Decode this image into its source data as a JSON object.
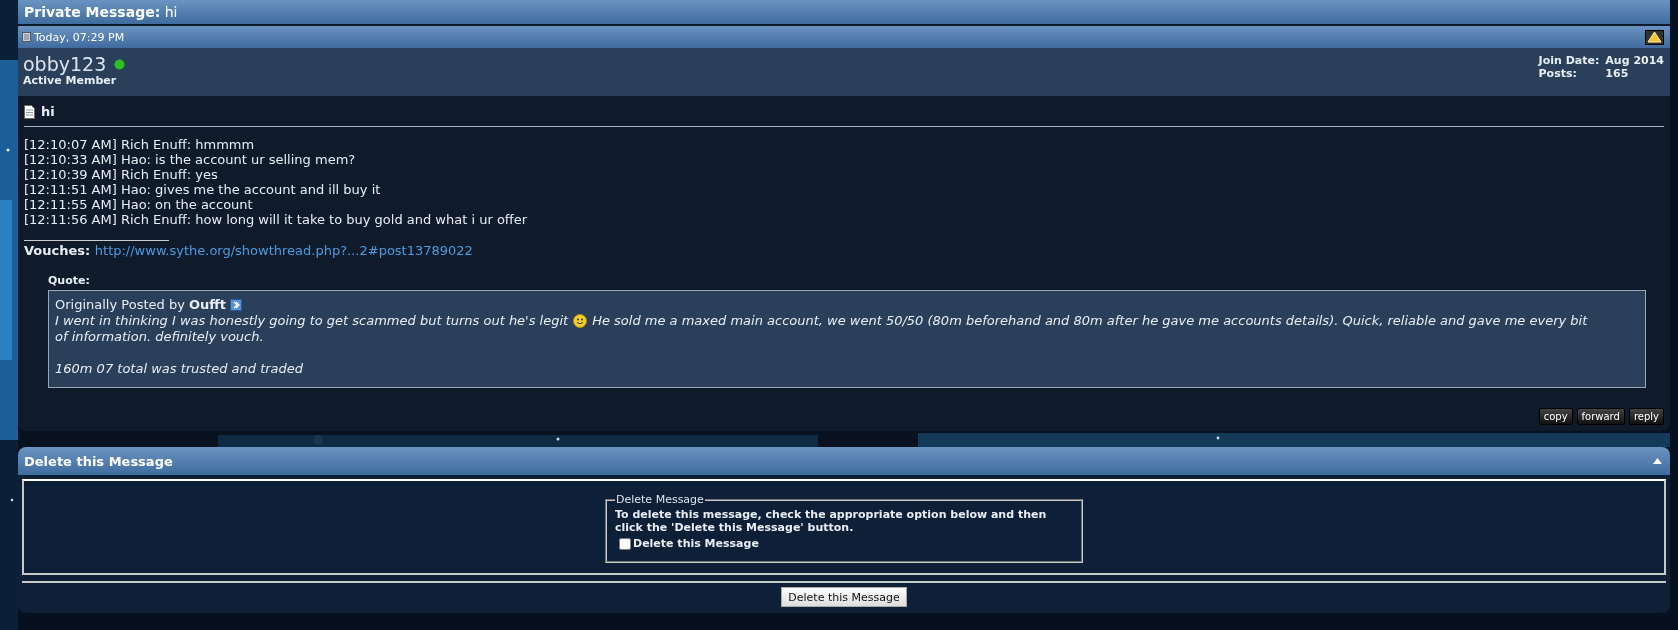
{
  "title": {
    "label": "Private Message:",
    "subject": "hi"
  },
  "post": {
    "date": "Today, 07:29 PM",
    "username": "obby123",
    "online": true,
    "rank": "Active Member",
    "stats": [
      {
        "label": "Join Date:",
        "value": "Aug 2014"
      },
      {
        "label": "Posts:",
        "value": "165"
      }
    ],
    "subject": "hi",
    "lines": [
      "[12:10:07 AM] Rich Enuff: hmmmm",
      "[12:10:33 AM] Hao: is the account ur selling mem?",
      "[12:10:39 AM] Rich Enuff: yes",
      "[12:11:51 AM] Hao: gives me the account and ill buy it",
      "[12:11:55 AM] Hao: on the account",
      "[12:11:56 AM] Rich Enuff: how long will it take to buy gold and what i ur offer"
    ],
    "signature": {
      "label": "Vouches:",
      "link": "http://www.sythe.org/showthread.php?...2#post13789022"
    },
    "quote": {
      "label": "Quote:",
      "posted_by": "Originally Posted by",
      "author": "Oufft",
      "before_smiley": "I went in thinking I was honestly going to get scammed but turns out he's legit",
      "after_smiley": "He sold me a maxed main account, we went 50/50 (80m beforehand and 80m after he gave me accounts details). Quick, reliable and gave me every bit",
      "continued": "of information. definitely vouch.",
      "last_line": "160m 07 total was trusted and traded"
    },
    "buttons": [
      "copy",
      "forward",
      "reply"
    ]
  },
  "delete": {
    "title": "Delete this Message",
    "legend": "Delete Message",
    "instructions": "To delete this message, check the appropriate option below and then click the 'Delete this Message' button.",
    "checkbox": {
      "label": "Delete this Message",
      "checked": false
    },
    "button": "Delete this Message"
  }
}
